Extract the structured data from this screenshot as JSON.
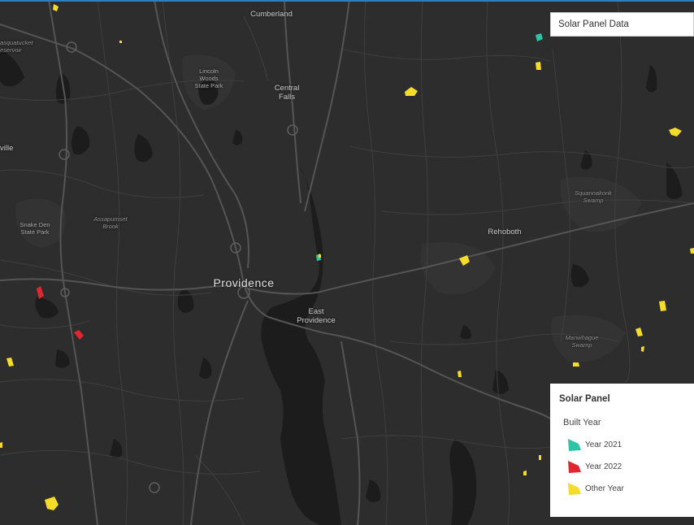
{
  "map": {
    "colors": {
      "background": "#2d2d2d",
      "water": "#1c1c1c",
      "road": "#4a4a4a",
      "major_road": "#555555",
      "park": "#333333"
    },
    "places": [
      {
        "name": "Cumberland",
        "type": "town"
      },
      {
        "name": "Central\nFalls",
        "type": "town"
      },
      {
        "name": "Lincoln\nWoods\nState Park",
        "type": "park"
      },
      {
        "name": "asquatucket\neservoir",
        "type": "water"
      },
      {
        "name": "ville",
        "type": "town"
      },
      {
        "name": "Snake Den\nState Park",
        "type": "park"
      },
      {
        "name": "Assapumset\nBrook",
        "type": "water"
      },
      {
        "name": "Providence",
        "type": "city"
      },
      {
        "name": "East\nProvidence",
        "type": "town"
      },
      {
        "name": "Rehoboth",
        "type": "town"
      },
      {
        "name": "Squannakonk\nSwamp",
        "type": "water"
      },
      {
        "name": "Manwhague\nSwamp",
        "type": "water"
      }
    ],
    "panels": [
      {
        "category": "Other Year"
      },
      {
        "category": "Other Year"
      },
      {
        "category": "Year 2021"
      },
      {
        "category": "Other Year"
      },
      {
        "category": "Other Year"
      },
      {
        "category": "Other Year"
      },
      {
        "category": "Year 2021"
      },
      {
        "category": "Other Year"
      },
      {
        "category": "Other Year"
      },
      {
        "category": "Year 2022"
      },
      {
        "category": "Year 2022"
      },
      {
        "category": "Other Year"
      },
      {
        "category": "Other Year"
      },
      {
        "category": "Other Year"
      },
      {
        "category": "Other Year"
      },
      {
        "category": "Other Year"
      },
      {
        "category": "Other Year"
      },
      {
        "category": "Other Year"
      },
      {
        "category": "Other Year"
      },
      {
        "category": "Other Year"
      },
      {
        "category": "Other Year"
      }
    ]
  },
  "search": {
    "title": "Solar Panel Data"
  },
  "legend": {
    "title": "Solar Panel",
    "subtitle": "Built Year",
    "items": [
      {
        "label": "Year 2021",
        "color": "#2ec4a5"
      },
      {
        "label": "Year 2022",
        "color": "#e0262f"
      },
      {
        "label": "Other Year",
        "color": "#f6dc2a"
      }
    ]
  }
}
